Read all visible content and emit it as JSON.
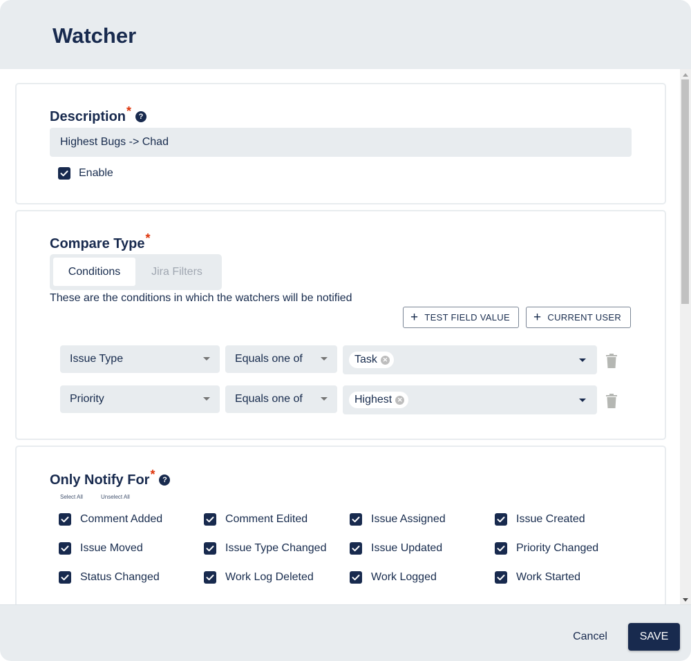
{
  "dialog": {
    "title": "Watcher"
  },
  "description_section": {
    "label": "Description",
    "required_mark": "*",
    "help_icon": "question-circle-icon",
    "help_glyph": "?",
    "value": "Highest Bugs -> Chad",
    "enable": {
      "label": "Enable",
      "checked": true
    }
  },
  "compare_section": {
    "label": "Compare Type",
    "required_mark": "*",
    "tabs": [
      {
        "label": "Conditions",
        "active": true
      },
      {
        "label": "Jira Filters",
        "active": false
      }
    ],
    "description": "These are the conditions in which the watchers will be notified",
    "buttons": {
      "test_field_value": "TEST FIELD VALUE",
      "current_user": "CURRENT USER",
      "plus_glyph": "+"
    },
    "conditions": [
      {
        "field": "Issue Type",
        "operator": "Equals one of",
        "values": [
          "Task"
        ]
      },
      {
        "field": "Priority",
        "operator": "Equals one of",
        "values": [
          "Highest"
        ]
      }
    ],
    "chip_remove_glyph": "✕"
  },
  "notify_section": {
    "label": "Only Notify For",
    "required_mark": "*",
    "help_glyph": "?",
    "select_all": "Select All",
    "unselect_all": "Unselect All",
    "events": [
      {
        "label": "Comment Added",
        "checked": true
      },
      {
        "label": "Comment Edited",
        "checked": true
      },
      {
        "label": "Issue Assigned",
        "checked": true
      },
      {
        "label": "Issue Created",
        "checked": true
      },
      {
        "label": "Issue Moved",
        "checked": true
      },
      {
        "label": "Issue Type Changed",
        "checked": true
      },
      {
        "label": "Issue Updated",
        "checked": true
      },
      {
        "label": "Priority Changed",
        "checked": true
      },
      {
        "label": "Status Changed",
        "checked": true
      },
      {
        "label": "Work Log Deleted",
        "checked": true
      },
      {
        "label": "Work Logged",
        "checked": true
      },
      {
        "label": "Work Started",
        "checked": true
      }
    ]
  },
  "footer": {
    "cancel": "Cancel",
    "save": "SAVE"
  },
  "colors": {
    "primary": "#182a4e",
    "header_bg": "#e8ecef",
    "required": "#de350b"
  }
}
